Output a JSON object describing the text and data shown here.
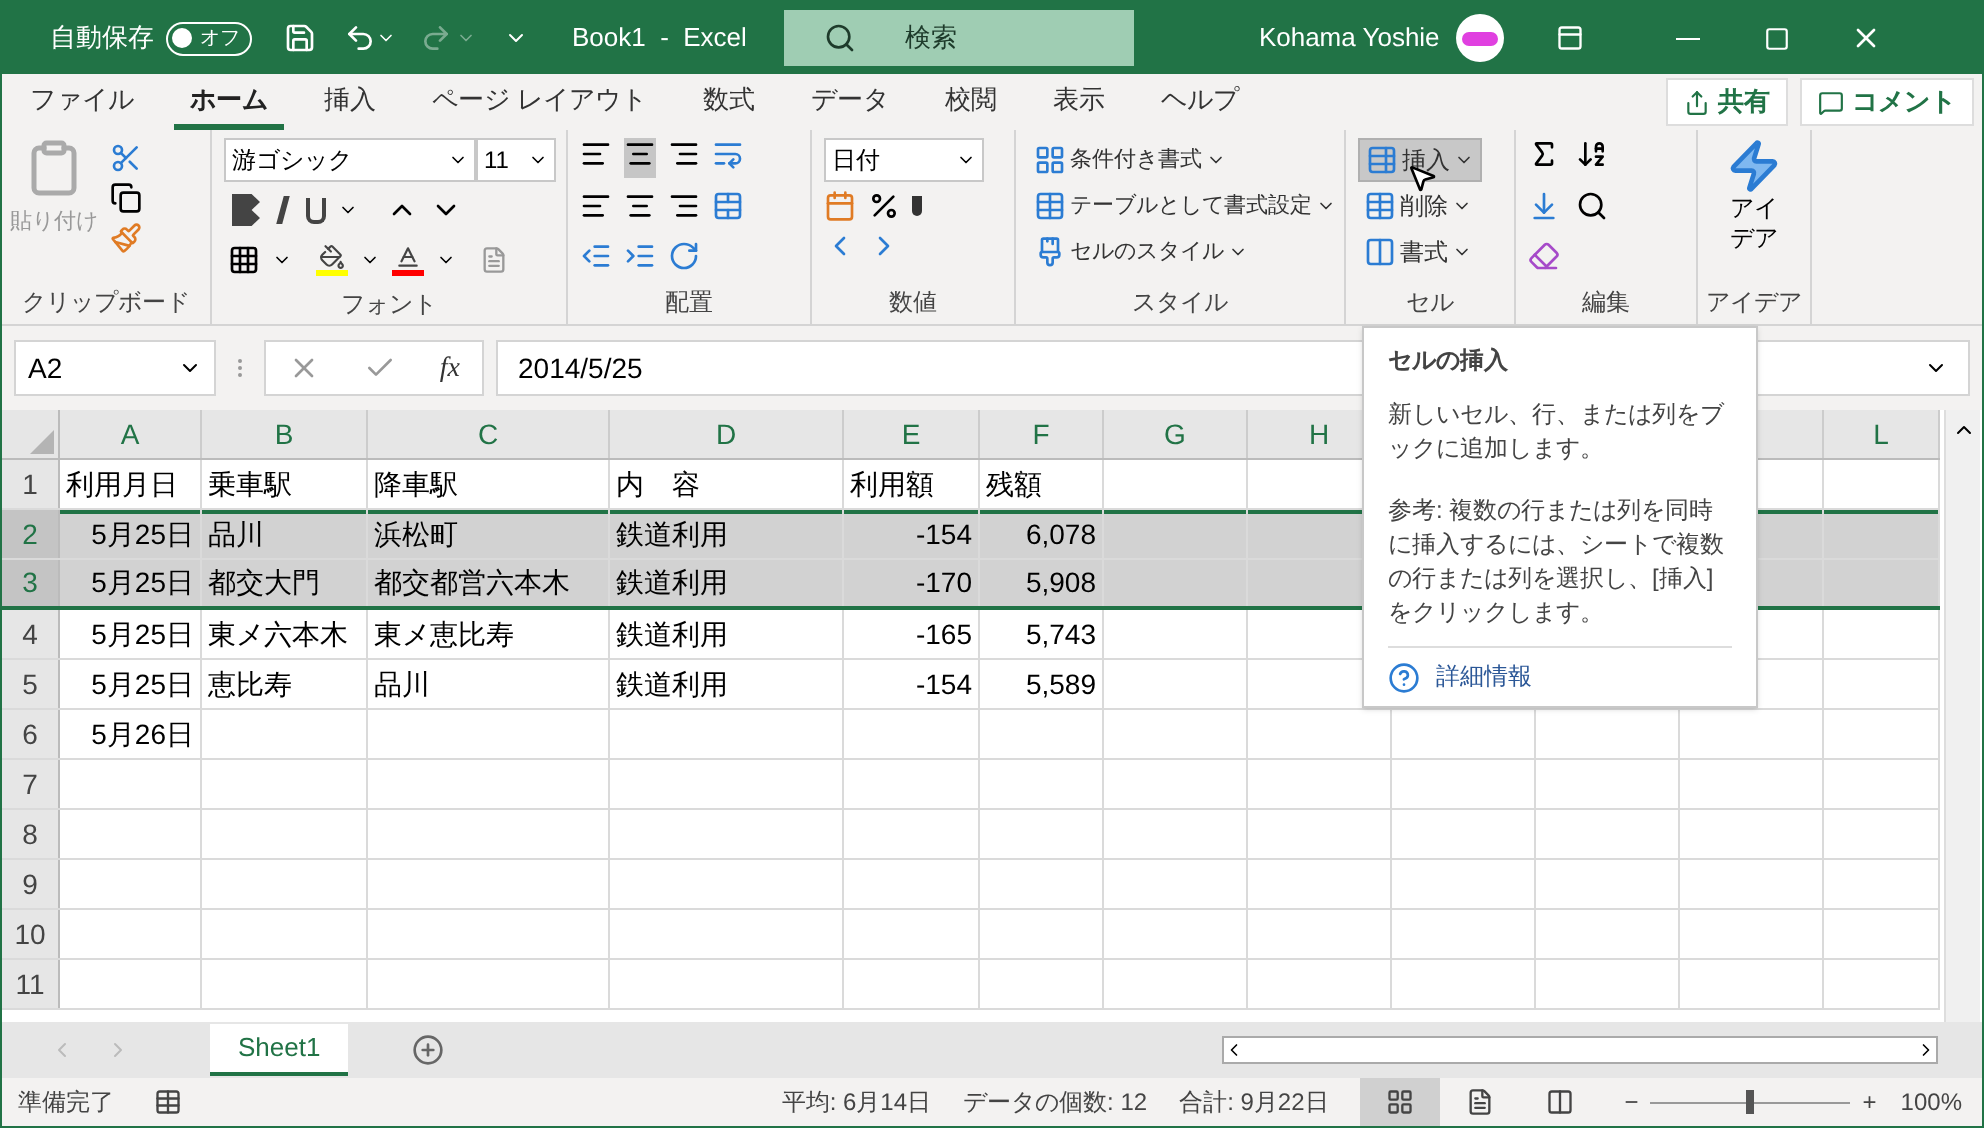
{
  "title_bar": {
    "autosave_label": "自動保存",
    "autosave_toggle": {
      "label": "オフ",
      "on": false
    },
    "title": "Book1  -  Excel",
    "search": "検索",
    "user": "Kohama Yoshie"
  },
  "ribbon_tabs": [
    {
      "label": "ファイル",
      "selected": false
    },
    {
      "label": "ホーム",
      "selected": true
    },
    {
      "label": "挿入",
      "selected": false
    },
    {
      "label": "ページ レイアウト",
      "selected": false
    },
    {
      "label": "数式",
      "selected": false
    },
    {
      "label": "データ",
      "selected": false
    },
    {
      "label": "校閲",
      "selected": false
    },
    {
      "label": "表示",
      "selected": false
    },
    {
      "label": "ヘルプ",
      "selected": false
    }
  ],
  "share_button": "共有",
  "comment_button": "コメント",
  "ribbon": {
    "clipboard": {
      "paste": "貼り付け",
      "label": "クリップボード"
    },
    "font": {
      "font_name": "游ゴシック",
      "font_size": "11",
      "label": "フォント"
    },
    "alignment": {
      "label": "配置"
    },
    "number": {
      "format": "日付",
      "label": "数値"
    },
    "styles": {
      "items": [
        "条件付き書式",
        "テーブルとして書式設定",
        "セルのスタイル"
      ],
      "label": "スタイル"
    },
    "cells": {
      "items": [
        {
          "label": "挿入",
          "selected": true
        },
        {
          "label": "削除",
          "selected": false
        },
        {
          "label": "書式",
          "selected": false
        }
      ],
      "label": "セル"
    },
    "editing": {
      "label": "編集"
    },
    "ideas": {
      "button": "アイデア",
      "label": "アイデア"
    }
  },
  "formula_bar": {
    "name_box": "A2",
    "fx": "fx",
    "value": "2014/5/25"
  },
  "sheet": {
    "columns": [
      {
        "label": "A",
        "kind": "number"
      },
      {
        "label": "B",
        "kind": "text"
      },
      {
        "label": "C",
        "kind": "text"
      },
      {
        "label": "D",
        "kind": "text"
      },
      {
        "label": "E",
        "kind": "number"
      },
      {
        "label": "F",
        "kind": "number"
      },
      {
        "label": "G",
        "kind": "text"
      },
      {
        "label": "H",
        "kind": "text"
      }
    ],
    "columns_right": [
      "L"
    ],
    "rows": [
      {
        "number": "1",
        "kind": "text",
        "selected": false,
        "cells": [
          "利用月日",
          "乗車駅",
          "降車駅",
          "内　容",
          "利用額",
          "残額"
        ]
      },
      {
        "number": "2",
        "kind": "data",
        "selected": true,
        "cells": [
          "5月25日",
          "品川",
          "浜松町",
          "鉄道利用",
          "-154",
          "6,078"
        ]
      },
      {
        "number": "3",
        "kind": "data",
        "selected": true,
        "cells": [
          "5月25日",
          "都交大門",
          "都交都営六本木",
          "鉄道利用",
          "-170",
          "5,908"
        ]
      },
      {
        "number": "4",
        "kind": "data",
        "selected": false,
        "cells": [
          "5月25日",
          "東メ六本木",
          "東メ恵比寿",
          "鉄道利用",
          "-165",
          "5,743"
        ]
      },
      {
        "number": "5",
        "kind": "data",
        "selected": false,
        "cells": [
          "5月25日",
          "恵比寿",
          "品川",
          "鉄道利用",
          "-154",
          "5,589"
        ]
      },
      {
        "number": "6",
        "kind": "data",
        "selected": false,
        "cells": [
          "5月26日"
        ]
      },
      {
        "number": "7",
        "kind": "data",
        "selected": false,
        "cells": []
      },
      {
        "number": "8",
        "kind": "data",
        "selected": false,
        "cells": []
      },
      {
        "number": "9",
        "kind": "data",
        "selected": false,
        "cells": []
      },
      {
        "number": "10",
        "kind": "data",
        "selected": false,
        "cells": []
      },
      {
        "number": "11",
        "kind": "data",
        "selected": false,
        "cells": []
      }
    ]
  },
  "tooltip": {
    "title": "セルの挿入",
    "description": "新しいセル、行、または列をブックに追加します。",
    "note": "参考: 複数の行または列を同時に挿入するには、シートで複数の行または列を選択し、[挿入] をクリックします。",
    "link": "詳細情報"
  },
  "sheet_tabs": [
    {
      "label": "Sheet1",
      "selected": true
    }
  ],
  "status_bar": {
    "ready": "準備完了",
    "stats": [
      "平均: 6月14日",
      "データの個数: 12",
      "合計: 9月22日"
    ],
    "views": [
      {
        "kind": "normal",
        "selected": true
      },
      {
        "kind": "page_layout",
        "selected": false
      },
      {
        "kind": "page_break",
        "selected": false
      }
    ],
    "zoom_minus": "−",
    "zoom_plus": "+",
    "level": 0.5,
    "zoom": "100%"
  }
}
